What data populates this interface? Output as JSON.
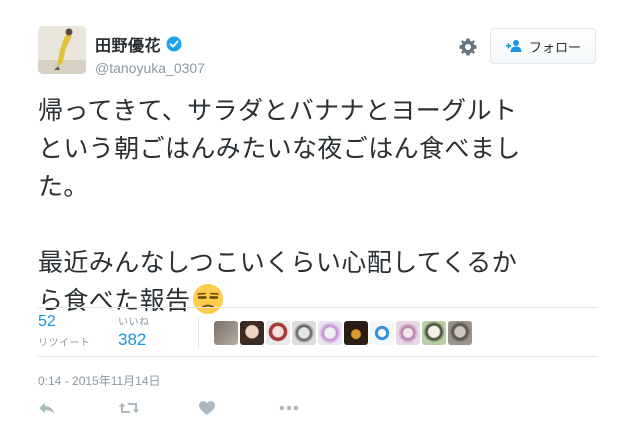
{
  "user": {
    "display_name": "田野優花",
    "handle": "@tanoyuka_0307"
  },
  "header": {
    "follow_label": "フォロー"
  },
  "tweet": {
    "lines": [
      "帰ってきて、サラダとバナナとヨーグルト",
      "という朝ごはんみたいな夜ごはん食べまし",
      "た。"
    ],
    "lines2": [
      "最近みんなしつこいくらい心配してくるか",
      "ら食べた報告"
    ],
    "emoji": "unamused-face"
  },
  "stats": {
    "retweets": "52",
    "retweets_label": "リツイート",
    "likes_label": "いいね",
    "likes": "382"
  },
  "timestamp": "0:14 - 2015年11月14日",
  "colors": {
    "accent": "#1b95e0",
    "muted": "#8899a6",
    "text": "#292f33",
    "border": "#e1e8ed"
  },
  "icons": {
    "verified": "verified-badge-icon",
    "settings": "gear-icon",
    "follow": "follow-person-icon",
    "reply": "reply-icon",
    "retweet": "retweet-icon",
    "like": "heart-icon",
    "more": "more-icon"
  }
}
